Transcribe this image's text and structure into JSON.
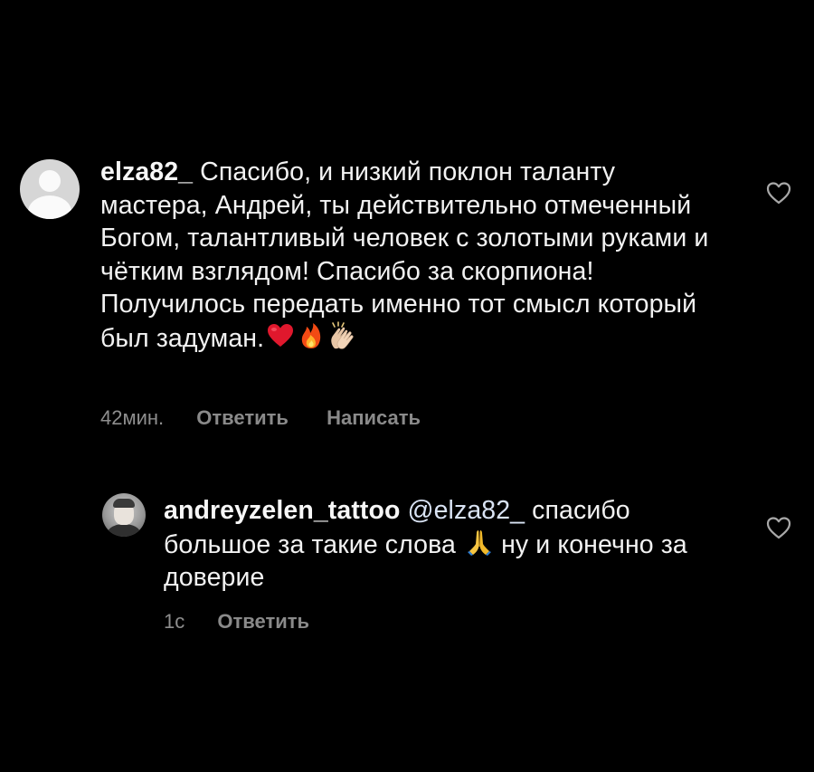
{
  "comments": [
    {
      "username": "elza82_",
      "text_part1": "Спасибо, и низкий поклон таланту мастера, Андрей, ты действительно отмеченный Богом, талантливый человек с золотыми руками и чётким взглядом! Спасибо за скорпиона!  Получилось передать именно тот смысл который  был задуман.",
      "emojis": [
        "heart-emoji",
        "fire-emoji",
        "clapping-hands-emoji"
      ],
      "time": "42мин.",
      "reply_label": "Ответить",
      "message_label": "Написать",
      "like_icon": "heart-outline-icon"
    },
    {
      "username": "andreyzelen_tattoo",
      "mention": "@elza82_",
      "text_part1": "спасибо большое за такие слова",
      "emoji": "folded-hands-emoji",
      "text_part2": "ну и конечно за доверие",
      "time": "1с",
      "reply_label": "Ответить",
      "like_icon": "heart-outline-icon"
    }
  ],
  "colors": {
    "background": "#000000",
    "text": "#f2f2f2",
    "meta": "#8e8e8e"
  }
}
